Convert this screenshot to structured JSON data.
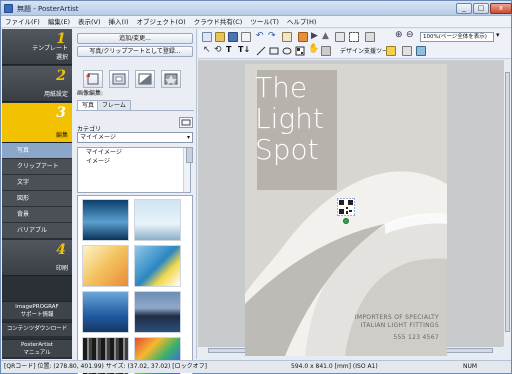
{
  "window": {
    "title": "無題 - PosterArtist",
    "buttons": {
      "minimize": "_",
      "maximize": "□",
      "close": "x"
    }
  },
  "menu": [
    "ファイル(F)",
    "編集(E)",
    "表示(V)",
    "挿入(I)",
    "オブジェクト(O)",
    "クラウド共有(C)",
    "ツール(T)",
    "ヘルプ(H)"
  ],
  "sidebar": {
    "steps": [
      {
        "num": "1",
        "label_line1": "テンプレート",
        "label_line2": "選択"
      },
      {
        "num": "2",
        "label_line1": "用紙設定",
        "label_line2": ""
      },
      {
        "num": "3",
        "label_line1": "編集",
        "label_line2": ""
      },
      {
        "num": "4",
        "label_line1": "印刷",
        "label_line2": ""
      }
    ],
    "subitems": [
      "写真",
      "クリップアート",
      "文字",
      "図形",
      "背景",
      "バリアブル"
    ],
    "bottom": [
      {
        "line1": "imagePROGRAF",
        "line2": "サポート情報"
      },
      {
        "line1": "コンテンツダウンロード",
        "line2": ""
      },
      {
        "line1": "PosterArtist",
        "line2": "マニュアル"
      }
    ]
  },
  "panel": {
    "add_change": "追加/変更...",
    "register": "写真/クリップアートとして登録...",
    "image_edit_label": "画像編集:",
    "tabs": [
      "写真",
      "フレーム"
    ],
    "category_label": "カテゴリ",
    "category_value": "マイイメージ",
    "list_items": [
      "マイイメージ",
      "イメージ"
    ]
  },
  "toolbar": {
    "zoom_value": "100%(ページ全体を表示)",
    "design_support": "デザイン支援ツール"
  },
  "poster": {
    "line1": "The",
    "line2": "Light",
    "line3": "Spot",
    "tag1": "IMPORTERS OF SPECIALTY",
    "tag2": "ITALIAN LIGHT FITTINGS",
    "phone": "555 123 4567"
  },
  "status": {
    "info": "[QRコード] 位置: (278.80, 401.99) サイズ: (37.02, 37.02) [ロックオフ]",
    "paper": "594.0 x 841.0 [mm] (ISO A1)",
    "num": "NUM"
  },
  "colors": {
    "accent": "#f2c200",
    "sidebar": "#2b2f36",
    "selected_sub": "#8aa7c9"
  }
}
